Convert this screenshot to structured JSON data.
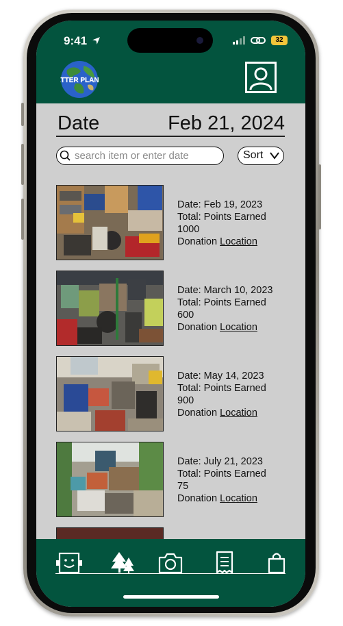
{
  "status": {
    "time": "9:41",
    "battery": "32"
  },
  "header": {
    "logo_text": "BETTER PLANET",
    "date_label": "Date",
    "date_value": "Feb 21, 2024"
  },
  "search": {
    "placeholder": "search item or enter date"
  },
  "sort": {
    "label": "Sort"
  },
  "items": [
    {
      "date": "Date: Feb 19, 2023",
      "total_label": "Total: Points Earned",
      "points": "1000",
      "donation_label": "Donation",
      "location_label": "Location"
    },
    {
      "date": "Date: March 10, 2023",
      "total_label": "Total: Points Earned",
      "points": "600",
      "donation_label": "Donation",
      "location_label": "Location"
    },
    {
      "date": "Date: May 14, 2023",
      "total_label": "Total: Points Earned",
      "points": "900",
      "donation_label": "Donation",
      "location_label": "Location"
    },
    {
      "date": "Date: July 21, 2023",
      "total_label": "Total: Points Earned",
      "points": "75",
      "donation_label": "Donation",
      "location_label": "Location"
    }
  ],
  "tabs": [
    {
      "icon": "robot-face-icon"
    },
    {
      "icon": "trees-icon"
    },
    {
      "icon": "camera-icon"
    },
    {
      "icon": "receipt-icon"
    },
    {
      "icon": "shopping-bag-icon"
    }
  ],
  "colors": {
    "brand_green": "#03543e",
    "content_bg": "#cfcfcf"
  }
}
